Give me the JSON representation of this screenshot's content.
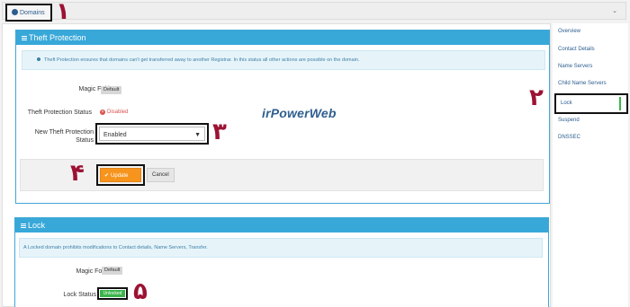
{
  "breadcrumb": {
    "label": "Domains"
  },
  "annotations": [
    "١",
    "٢",
    "٣",
    "۴",
    "۵"
  ],
  "watermark": "irPowerWeb",
  "theft_panel": {
    "title": "Theft Protection",
    "info": "Theft Protection ensures that domains can't get transferred away to another Registrar. In this status all other actions are possible on the domain.",
    "magic_folder_label": "Magic Folder",
    "magic_folder_value": "Default",
    "status_label": "Theft Protection Status",
    "status_value": "Disabled",
    "new_label_line1": "New Theft Protection",
    "new_label_line2": "Status",
    "select_value": "Enabled",
    "update_label": "Update",
    "cancel_label": "Cancel"
  },
  "lock_panel": {
    "title": "Lock",
    "info": "A Locked domain prohibits modifications to Contact details, Name Servers, Transfer.",
    "magic_folder_label": "Magic Folder",
    "magic_folder_value": "Default",
    "status_label": "Lock Status",
    "status_value": "Unlocked"
  },
  "sidebar": {
    "items": [
      "Overview",
      "Contact Details",
      "Name Servers",
      "Child Name Servers",
      "Lock",
      "Suspend",
      "DNSSEC"
    ],
    "active": "Lock"
  },
  "colors": {
    "panel_header": "#38a8d9",
    "update_button": "#f7941d",
    "disabled": "#d9534f",
    "unlocked": "#3cb44b",
    "annotation": "#9c1233"
  }
}
